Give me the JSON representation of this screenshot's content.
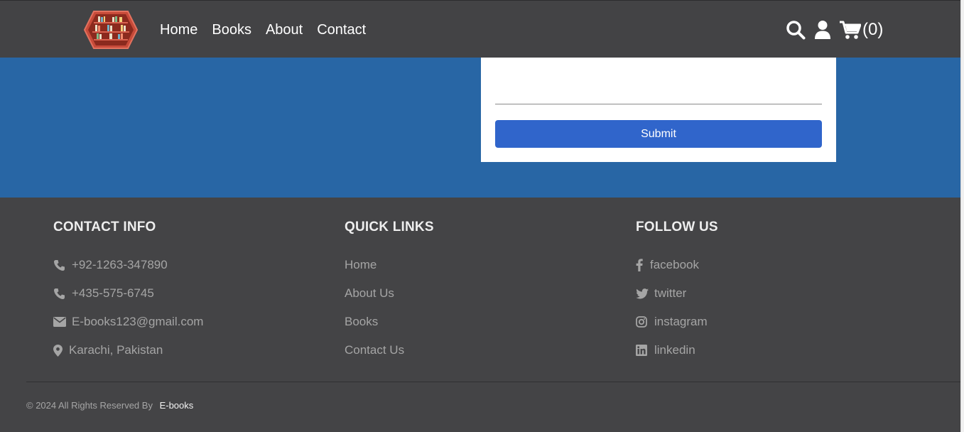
{
  "header": {
    "nav": [
      "Home",
      "Books",
      "About",
      "Contact"
    ],
    "cart_count": "(0)",
    "icons": [
      "search-icon",
      "user-icon",
      "cart-icon"
    ]
  },
  "form": {
    "submit_label": "Submit"
  },
  "footer": {
    "contact": {
      "title": "CONTACT INFO",
      "items": [
        {
          "icon": "phone-icon",
          "text": "+92-1263-347890"
        },
        {
          "icon": "phone-icon",
          "text": "+435-575-6745"
        },
        {
          "icon": "envelope-icon",
          "text": "E-books123@gmail.com"
        },
        {
          "icon": "map-pin-icon",
          "text": "Karachi, Pakistan"
        }
      ]
    },
    "quick_links": {
      "title": "QUICK LINKS",
      "items": [
        "Home",
        "About Us",
        "Books",
        "Contact Us"
      ]
    },
    "follow": {
      "title": "FOLLOW US",
      "items": [
        {
          "icon": "facebook-icon",
          "text": "facebook"
        },
        {
          "icon": "twitter-icon",
          "text": "twitter"
        },
        {
          "icon": "instagram-icon",
          "text": "instagram"
        },
        {
          "icon": "linkedin-icon",
          "text": "linkedin"
        }
      ]
    },
    "copyright": "© 2024 All Rights Reserved By",
    "brand": "E-books"
  },
  "colors": {
    "header_bg": "#434345",
    "hero_bg": "#2866a5",
    "submit_bg": "#3065cb",
    "footer_bg": "#444446"
  }
}
